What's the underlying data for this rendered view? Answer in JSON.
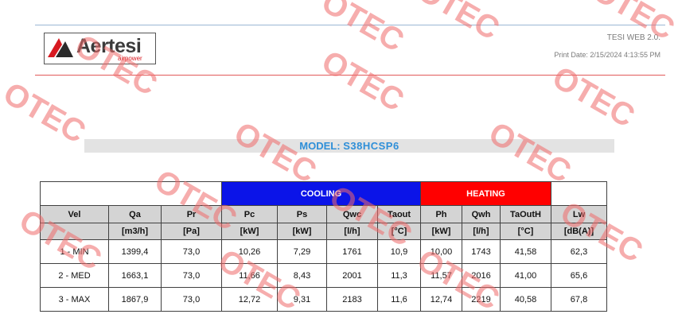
{
  "header": {
    "logo_text": "Aertesi",
    "logo_sub": "airpower",
    "app_name": "TESI WEB 2.0.",
    "print_date": "Print Date: 2/15/2024 4:13:55 PM"
  },
  "model": {
    "label": "MODEL:",
    "value": "S38HCSP6"
  },
  "table": {
    "sections": {
      "cooling": "COOLING",
      "heating": "HEATING"
    },
    "columns": [
      "Vel",
      "Qa",
      "Pr",
      "Pc",
      "Ps",
      "Qwc",
      "Taout",
      "Ph",
      "Qwh",
      "TaOutH",
      "Lw"
    ],
    "units": [
      "",
      "[m3/h]",
      "[Pa]",
      "[kW]",
      "[kW]",
      "[l/h]",
      "[°C]",
      "[kW]",
      "[l/h]",
      "[°C]",
      "[dB(A)]"
    ],
    "rows": [
      [
        "1 - MIN",
        "1399,4",
        "73,0",
        "10,26",
        "7,29",
        "1761",
        "10,9",
        "10,00",
        "1743",
        "41,58",
        "62,3"
      ],
      [
        "2 - MED",
        "1663,1",
        "73,0",
        "11,66",
        "8,43",
        "2001",
        "11,3",
        "11,57",
        "2016",
        "41,00",
        "65,6"
      ],
      [
        "3 - MAX",
        "1867,9",
        "73,0",
        "12,72",
        "9,31",
        "2183",
        "11,6",
        "12,74",
        "2219",
        "40,58",
        "67,8"
      ]
    ]
  },
  "watermark": "OTEC",
  "colors": {
    "cooling": "#0b14e8",
    "heating": "#ff0000",
    "model_text": "#2f8fd8",
    "watermark": "#f06b6b"
  }
}
